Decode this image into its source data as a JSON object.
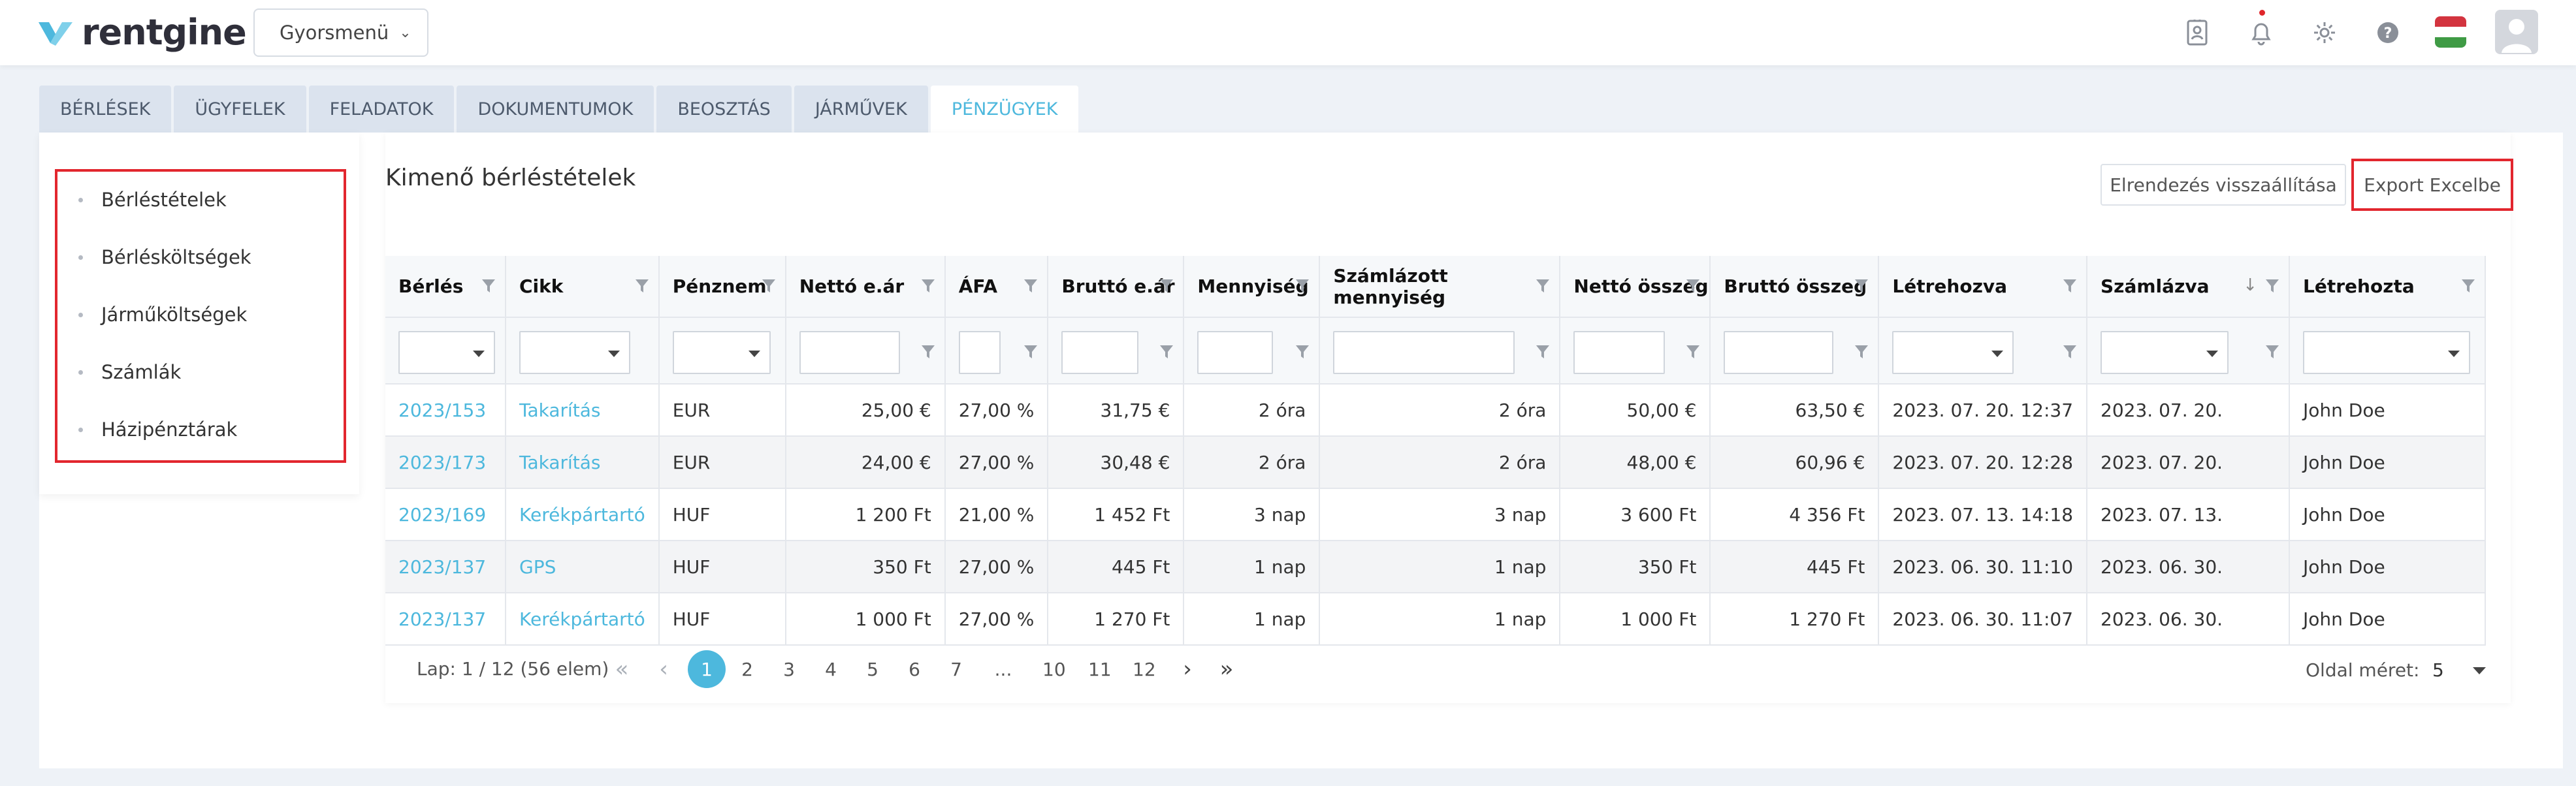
{
  "header": {
    "logo_text": "rentgine",
    "quick_menu_label": "Gyorsmenü"
  },
  "tabs": [
    {
      "label": "BÉRLÉSEK"
    },
    {
      "label": "ÜGYFELEK"
    },
    {
      "label": "FELADATOK"
    },
    {
      "label": "DOKUMENTUMOK"
    },
    {
      "label": "BEOSZTÁS"
    },
    {
      "label": "JÁRMŰVEK"
    },
    {
      "label": "PÉNZÜGYEK"
    }
  ],
  "sidebar": {
    "items": [
      {
        "label": "Bérléstételek"
      },
      {
        "label": "Bérlésköltségek"
      },
      {
        "label": "Járműköltségek"
      },
      {
        "label": "Számlák"
      },
      {
        "label": "Házipénztárak"
      }
    ]
  },
  "main": {
    "title": "Kimenő bérléstételek",
    "reset_label": "Elrendezés visszaállítása",
    "export_label": "Export Excelbe"
  },
  "table": {
    "columns": [
      "Bérlés",
      "Cikk",
      "Pénznem",
      "Nettó e.ár",
      "ÁFA",
      "Bruttó e.ár",
      "Mennyiség",
      "Számlázott mennyiség",
      "Nettó összeg",
      "Bruttó összeg",
      "Létrehozva",
      "Számlázva",
      "Létrehozta"
    ],
    "sort_indicator": "↓",
    "rows": [
      [
        "2023/153",
        "Takarítás",
        "EUR",
        "25,00 €",
        "27,00 %",
        "31,75 €",
        "2 óra",
        "2 óra",
        "50,00 €",
        "63,50 €",
        "2023. 07. 20. 12:37",
        "2023. 07. 20.",
        "John Doe"
      ],
      [
        "2023/173",
        "Takarítás",
        "EUR",
        "24,00 €",
        "27,00 %",
        "30,48 €",
        "2 óra",
        "2 óra",
        "48,00 €",
        "60,96 €",
        "2023. 07. 20. 12:28",
        "2023. 07. 20.",
        "John Doe"
      ],
      [
        "2023/169",
        "Kerékpártartó",
        "HUF",
        "1 200 Ft",
        "21,00 %",
        "1 452 Ft",
        "3 nap",
        "3 nap",
        "3 600 Ft",
        "4 356 Ft",
        "2023. 07. 13. 14:18",
        "2023. 07. 13.",
        "John Doe"
      ],
      [
        "2023/137",
        "GPS",
        "HUF",
        "350 Ft",
        "27,00 %",
        "445 Ft",
        "1 nap",
        "1 nap",
        "350 Ft",
        "445 Ft",
        "2023. 06. 30. 11:10",
        "2023. 06. 30.",
        "John Doe"
      ],
      [
        "2023/137",
        "Kerékpártartó",
        "HUF",
        "1 000 Ft",
        "27,00 %",
        "1 270 Ft",
        "1 nap",
        "1 nap",
        "1 000 Ft",
        "1 270 Ft",
        "2023. 06. 30. 11:07",
        "2023. 06. 30.",
        "John Doe"
      ]
    ]
  },
  "pager": {
    "info": "Lap: 1 / 12 (56 elem)",
    "pages": [
      "1",
      "2",
      "3",
      "4",
      "5",
      "6",
      "7",
      "...",
      "10",
      "11",
      "12"
    ],
    "current_page": "1",
    "page_size_label": "Oldal méret:",
    "page_size": "5"
  },
  "colors": {
    "accent": "#4db8dd",
    "highlight_border": "#e2262e",
    "tab_bg": "#dbe3ee"
  },
  "icons": [
    "contacts-icon",
    "bell-icon",
    "gear-icon",
    "help-icon",
    "hungarian-flag-icon",
    "user-avatar-icon",
    "filter-icon",
    "chevron-down-icon"
  ]
}
